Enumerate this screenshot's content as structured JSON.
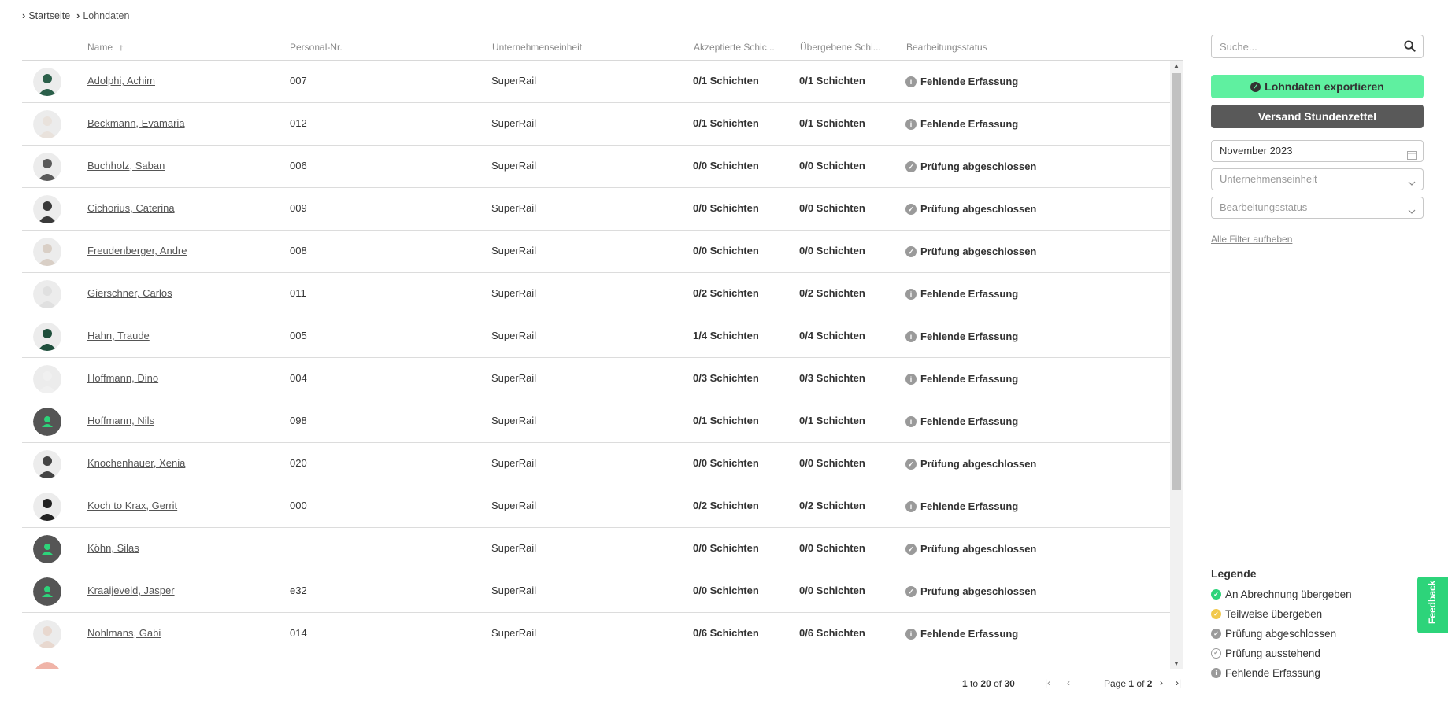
{
  "breadcrumb": {
    "home": "Startseite",
    "current": "Lohndaten"
  },
  "columns": {
    "name": "Name",
    "personal_nr": "Personal-Nr.",
    "unit": "Unternehmenseinheit",
    "accepted": "Akzeptierte Schic...",
    "submitted": "Übergebene Schi...",
    "status": "Bearbeitungsstatus"
  },
  "rows": [
    {
      "name": "Adolphi, Achim",
      "nr": "007",
      "unit": "SuperRail",
      "accepted": "0/1 Schichten",
      "submitted": "0/1 Schichten",
      "status": "Fehlende Erfassung",
      "status_icon": "info",
      "avatar": "photo"
    },
    {
      "name": "Beckmann, Evamaria",
      "nr": "012",
      "unit": "SuperRail",
      "accepted": "0/1 Schichten",
      "submitted": "0/1 Schichten",
      "status": "Fehlende Erfassung",
      "status_icon": "info",
      "avatar": "photo"
    },
    {
      "name": "Buchholz, Saban",
      "nr": "006",
      "unit": "SuperRail",
      "accepted": "0/0 Schichten",
      "submitted": "0/0 Schichten",
      "status": "Prüfung abgeschlossen",
      "status_icon": "check",
      "avatar": "photo"
    },
    {
      "name": "Cichorius, Caterina",
      "nr": "009",
      "unit": "SuperRail",
      "accepted": "0/0 Schichten",
      "submitted": "0/0 Schichten",
      "status": "Prüfung abgeschlossen",
      "status_icon": "check",
      "avatar": "photo"
    },
    {
      "name": "Freudenberger, Andre",
      "nr": "008",
      "unit": "SuperRail",
      "accepted": "0/0 Schichten",
      "submitted": "0/0 Schichten",
      "status": "Prüfung abgeschlossen",
      "status_icon": "check",
      "avatar": "photo"
    },
    {
      "name": "Gierschner, Carlos",
      "nr": "011",
      "unit": "SuperRail",
      "accepted": "0/2 Schichten",
      "submitted": "0/2 Schichten",
      "status": "Fehlende Erfassung",
      "status_icon": "info",
      "avatar": "photo"
    },
    {
      "name": "Hahn, Traude",
      "nr": "005",
      "unit": "SuperRail",
      "accepted": "1/4 Schichten",
      "submitted": "0/4 Schichten",
      "status": "Fehlende Erfassung",
      "status_icon": "info",
      "avatar": "photo"
    },
    {
      "name": "Hoffmann, Dino",
      "nr": "004",
      "unit": "SuperRail",
      "accepted": "0/3 Schichten",
      "submitted": "0/3 Schichten",
      "status": "Fehlende Erfassung",
      "status_icon": "info",
      "avatar": "photo"
    },
    {
      "name": "Hoffmann, Nils",
      "nr": "098",
      "unit": "SuperRail",
      "accepted": "0/1 Schichten",
      "submitted": "0/1 Schichten",
      "status": "Fehlende Erfassung",
      "status_icon": "info",
      "avatar": "placeholder"
    },
    {
      "name": "Knochenhauer, Xenia",
      "nr": "020",
      "unit": "SuperRail",
      "accepted": "0/0 Schichten",
      "submitted": "0/0 Schichten",
      "status": "Prüfung abgeschlossen",
      "status_icon": "check",
      "avatar": "photo"
    },
    {
      "name": "Koch to Krax, Gerrit",
      "nr": "000",
      "unit": "SuperRail",
      "accepted": "0/2 Schichten",
      "submitted": "0/2 Schichten",
      "status": "Fehlende Erfassung",
      "status_icon": "info",
      "avatar": "photo"
    },
    {
      "name": "Köhn, Silas",
      "nr": "",
      "unit": "SuperRail",
      "accepted": "0/0 Schichten",
      "submitted": "0/0 Schichten",
      "status": "Prüfung abgeschlossen",
      "status_icon": "check",
      "avatar": "placeholder"
    },
    {
      "name": "Kraaijeveld, Jasper",
      "nr": "e32",
      "unit": "SuperRail",
      "accepted": "0/0 Schichten",
      "submitted": "0/0 Schichten",
      "status": "Prüfung abgeschlossen",
      "status_icon": "check",
      "avatar": "placeholder"
    },
    {
      "name": "Nohlmans, Gabi",
      "nr": "014",
      "unit": "SuperRail",
      "accepted": "0/6 Schichten",
      "submitted": "0/6 Schichten",
      "status": "Fehlende Erfassung",
      "status_icon": "info",
      "avatar": "photo"
    }
  ],
  "paging": {
    "from": "1",
    "to_word": "to",
    "to": "20",
    "of_word": "of",
    "total": "30",
    "page_word": "Page",
    "page": "1",
    "page_of_word": "of",
    "pages": "2"
  },
  "sidebar": {
    "search_placeholder": "Suche...",
    "export_label": "Lohndaten exportieren",
    "send_label": "Versand Stundenzettel",
    "month_value": "November 2023",
    "unit_placeholder": "Unternehmenseinheit",
    "status_placeholder": "Bearbeitungsstatus",
    "clear_filters": "Alle Filter aufheben"
  },
  "legend": {
    "title": "Legende",
    "items": [
      {
        "label": "An Abrechnung übergeben",
        "color": "#2dd47a",
        "icon": "check-icon"
      },
      {
        "label": "Teilweise übergeben",
        "color": "#f2c94c",
        "icon": "check-icon"
      },
      {
        "label": "Prüfung abgeschlossen",
        "color": "#9a9a9a",
        "icon": "check-icon"
      },
      {
        "label": "Prüfung ausstehend",
        "color": "#ffffff",
        "icon": "check-outline-icon"
      },
      {
        "label": "Fehlende Erfassung",
        "color": "#9a9a9a",
        "icon": "info-icon"
      }
    ]
  },
  "feedback_label": "Feedback",
  "colors": {
    "accent_green": "#5ff0a0",
    "dark_button": "#595959",
    "feedback": "#2dd47a"
  }
}
